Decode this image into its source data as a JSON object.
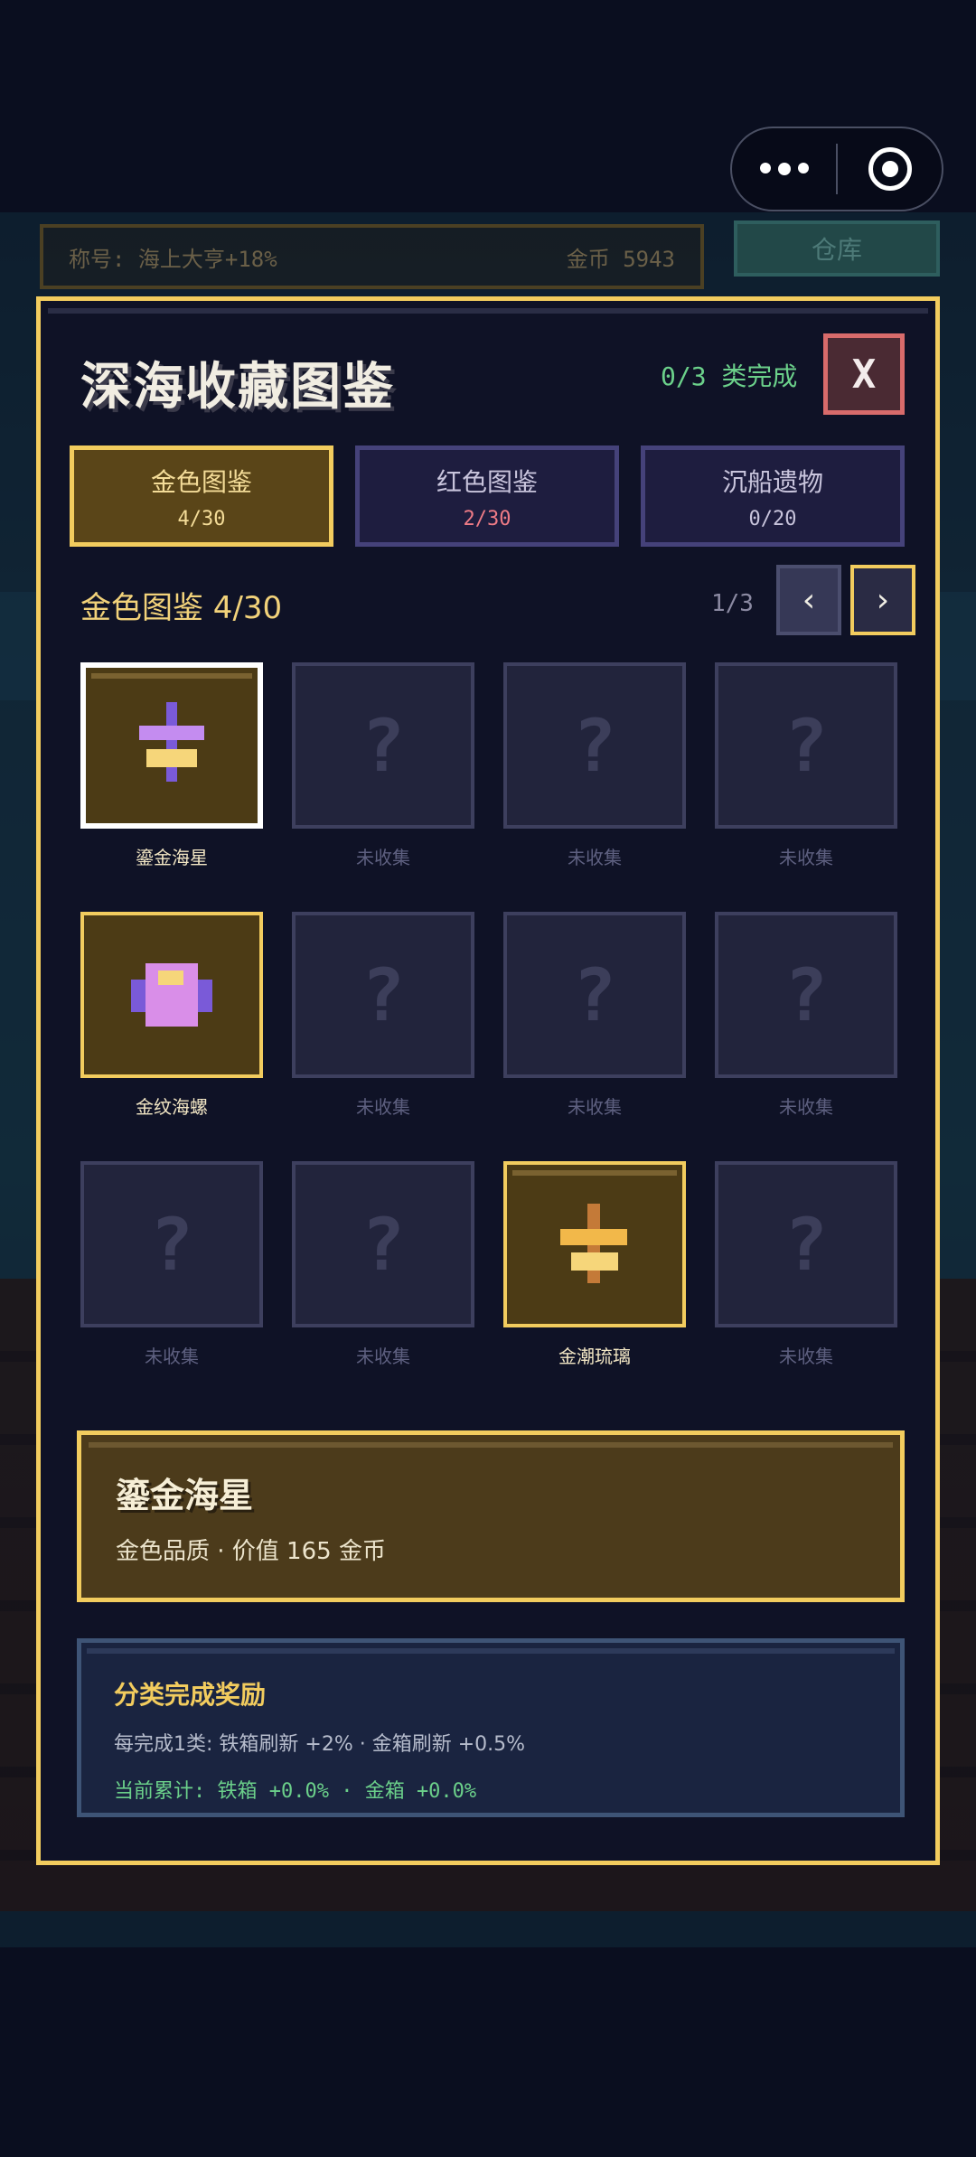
{
  "hud": {
    "title_label": "称号: 海上大亨+18%",
    "gold_label": "金币 5943",
    "store_label": "仓库"
  },
  "modal": {
    "title": "深海收藏图鉴",
    "progress": "0/3 类完成",
    "close_label": "X"
  },
  "tabs": [
    {
      "label": "金色图鉴",
      "count": "4/30"
    },
    {
      "label": "红色图鉴",
      "count": "2/30"
    },
    {
      "label": "沉船遗物",
      "count": "0/20"
    }
  ],
  "section": {
    "title": "金色图鉴 4/30",
    "page": "1/3",
    "prev_label": "‹",
    "next_label": "›"
  },
  "items": [
    {
      "name": "鎏金海星",
      "collected": true,
      "icon": "starfish-icon"
    },
    {
      "name": "未收集",
      "collected": false
    },
    {
      "name": "未收集",
      "collected": false
    },
    {
      "name": "未收集",
      "collected": false
    },
    {
      "name": "金纹海螺",
      "collected": true,
      "icon": "conch-icon"
    },
    {
      "name": "未收集",
      "collected": false
    },
    {
      "name": "未收集",
      "collected": false
    },
    {
      "name": "未收集",
      "collected": false
    },
    {
      "name": "未收集",
      "collected": false
    },
    {
      "name": "未收集",
      "collected": false
    },
    {
      "name": "金潮琉璃",
      "collected": true,
      "icon": "glass-icon"
    },
    {
      "name": "未收集",
      "collected": false
    }
  ],
  "unknown_mark": "?",
  "detail": {
    "name": "鎏金海星",
    "info": "金色品质 · 价值 165 金币"
  },
  "reward": {
    "title": "分类完成奖励",
    "line1": "每完成1类: 铁箱刷新 +2% · 金箱刷新 +0.5%",
    "line2": "当前累计: 铁箱 +0.0% · 金箱 +0.0%"
  },
  "colors": {
    "accent_gold": "#f2cc5e",
    "progress_green": "#6bd08a",
    "close_red": "#d86b6b"
  }
}
